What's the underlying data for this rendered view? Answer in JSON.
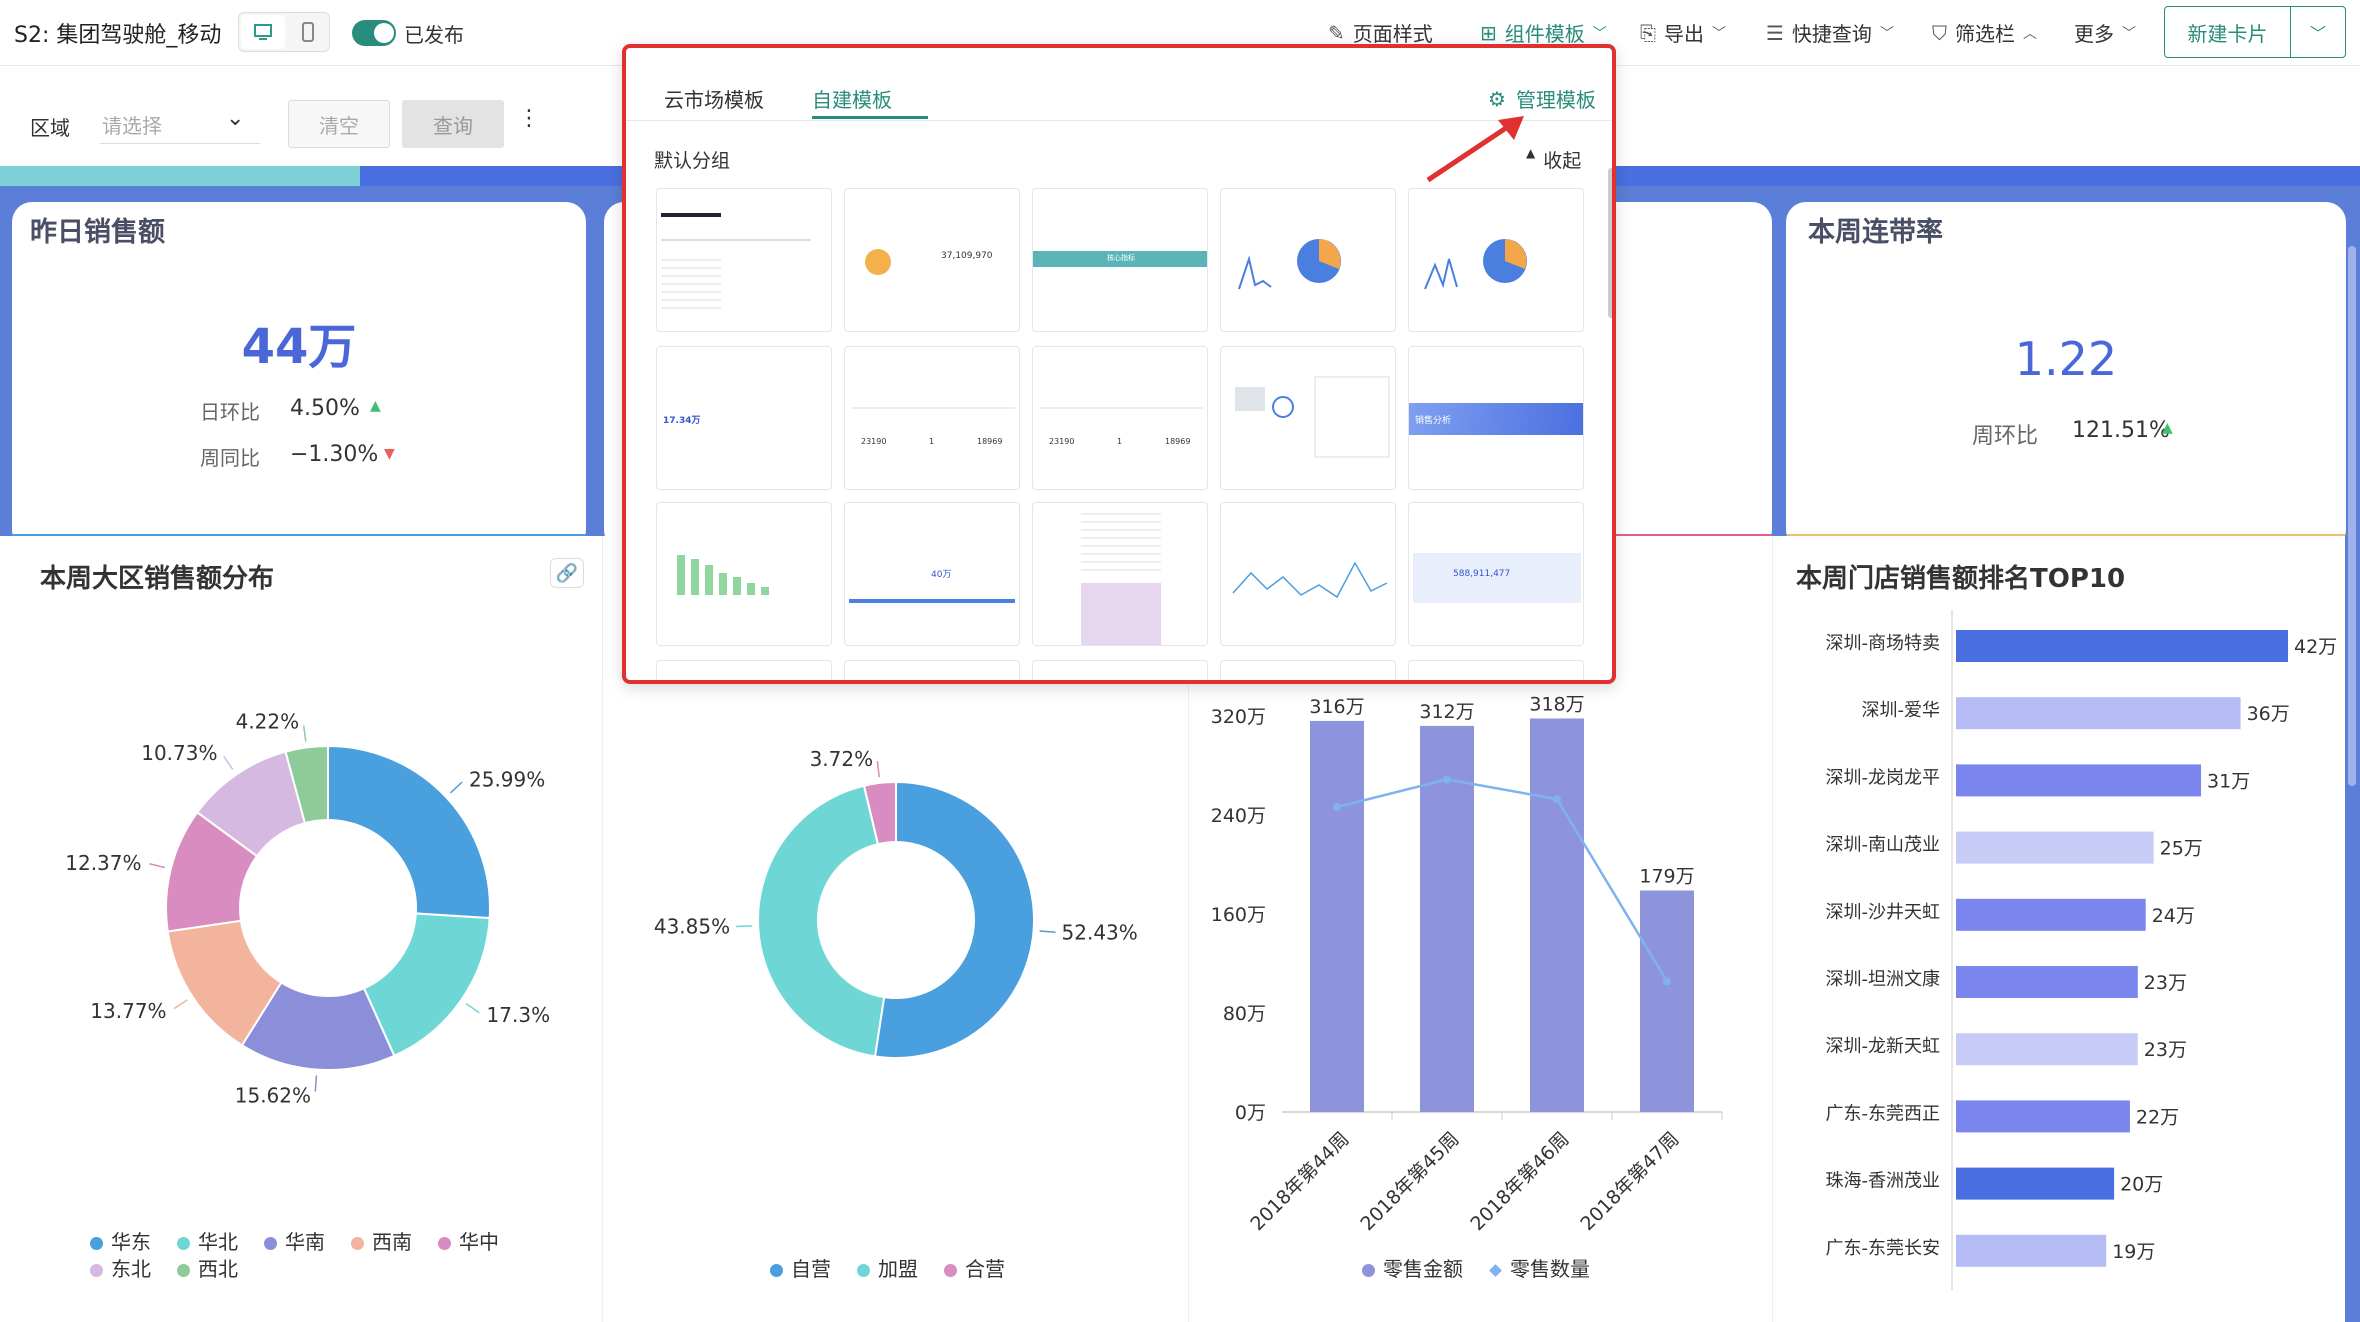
{
  "header": {
    "title": "S2: 集团驾驶舱_移动",
    "published_label": "已发布",
    "page_style": "页面样式",
    "component_template": "组件模板",
    "export": "导出",
    "quick_query": "快捷查询",
    "filter_bar": "筛选栏",
    "more": "更多",
    "new_card": "新建卡片"
  },
  "filter": {
    "label": "区域",
    "placeholder": "请选择",
    "clear": "清空",
    "query": "查询"
  },
  "kpi1": {
    "title": "昨日销售额",
    "value": "44万",
    "m1_label": "日环比",
    "m1_value": "4.50%",
    "m2_label": "周同比",
    "m2_value": "−1.30%"
  },
  "kpi4": {
    "title": "本周连带率",
    "value": "1.22",
    "m1_label": "周环比",
    "m1_value": "121.51%"
  },
  "popup": {
    "tab1": "云市场模板",
    "tab2": "自建模板",
    "manage": "管理模板",
    "group": "默认分组",
    "collapse": "收起",
    "thumb_texts": {
      "t2": "37,109,970",
      "t3": "核心指标",
      "t6": "17.34万",
      "t7a": "23190",
      "t7b": "1",
      "t7c": "18969",
      "t8a": "23190",
      "t8b": "1",
      "t8c": "18969",
      "t10": "销售分析",
      "t12": "40万",
      "t15": "588,911,477"
    }
  },
  "chart_donut1": {
    "title": "本周大区销售额分布"
  },
  "chart_data": [
    {
      "type": "pie",
      "title": "本周大区销售额分布",
      "categories": [
        "华东",
        "华北",
        "华南",
        "西南",
        "华中",
        "东北",
        "西北"
      ],
      "values": [
        25.99,
        17.3,
        15.62,
        13.77,
        12.37,
        10.73,
        4.22
      ],
      "labels": [
        "25.99%",
        "17.3%",
        "15.62%",
        "13.77%",
        "12.37%",
        "10.73%",
        "4.22%"
      ],
      "colors": [
        "#4a9fdf",
        "#6fd6d6",
        "#8b8ed9",
        "#f2b49c",
        "#d88cc0",
        "#d6b9e0",
        "#8dcc99"
      ],
      "legend": "bottom"
    },
    {
      "type": "pie",
      "categories": [
        "自营",
        "加盟",
        "合营"
      ],
      "values": [
        52.43,
        43.85,
        3.72
      ],
      "labels": [
        "52.43%",
        "43.85%",
        "3.72%"
      ],
      "colors": [
        "#4a9fdf",
        "#6fd6d6",
        "#d88cc0"
      ],
      "legend": "bottom"
    },
    {
      "type": "bar",
      "categories": [
        "2018年第44周",
        "2018年第45周",
        "2018年第46周",
        "2018年第47周"
      ],
      "series": [
        {
          "name": "零售金额",
          "type": "bar",
          "values": [
            316,
            312,
            318,
            179
          ],
          "labels": [
            "316万",
            "312万",
            "318万",
            "179万"
          ]
        },
        {
          "name": "零售数量",
          "type": "line"
        }
      ],
      "yticks": [
        "0万",
        "80万",
        "160万",
        "240万",
        "320万"
      ],
      "ylim": [
        0,
        320
      ],
      "legend": "bottom"
    },
    {
      "type": "bar",
      "orientation": "horizontal",
      "title": "本周门店销售额排名TOP10",
      "categories": [
        "深圳-商场特卖",
        "深圳-爱华",
        "深圳-龙岗龙平",
        "深圳-南山茂业",
        "深圳-沙井天虹",
        "深圳-坦洲文康",
        "深圳-龙新天虹",
        "广东-东莞西正",
        "珠海-香洲茂业",
        "广东-东莞长安"
      ],
      "values": [
        42,
        36,
        31,
        25,
        24,
        23,
        23,
        22,
        20,
        19
      ],
      "labels": [
        "42万",
        "36万",
        "31万",
        "25万",
        "24万",
        "23万",
        "23万",
        "22万",
        "20万",
        "19万"
      ],
      "colors": [
        "#4a6fe0",
        "#b5bcf5",
        "#7a86ee",
        "#c7ccf7",
        "#7a86ee",
        "#7a86ee",
        "#c7ccf7",
        "#7a86ee",
        "#4a6fe0",
        "#b5bcf5"
      ]
    }
  ]
}
